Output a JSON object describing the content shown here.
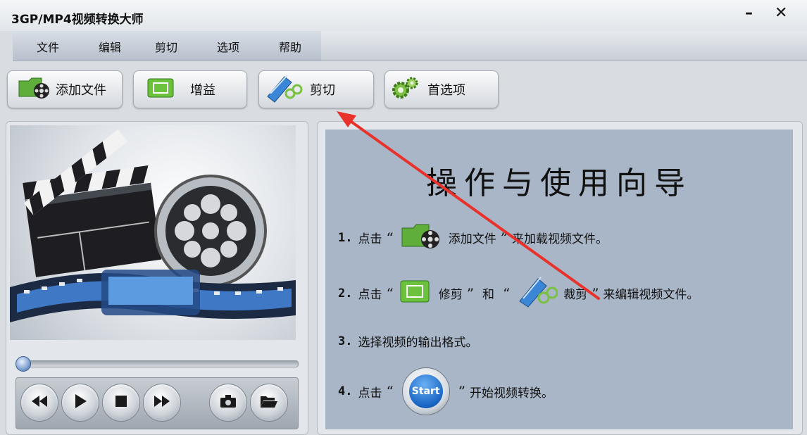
{
  "window": {
    "title": "3GP/MP4视频转换大师",
    "minimize_glyph": "–",
    "close_glyph": "✕"
  },
  "menu": {
    "items": [
      "文件",
      "编辑",
      "剪切",
      "选项",
      "帮助"
    ]
  },
  "toolbar": {
    "add_file": "添加文件",
    "gain": "增益",
    "cut": "剪切",
    "preferences": "首选项"
  },
  "player": {
    "seek_progress": 0,
    "controls": [
      "rewind-icon",
      "play-icon",
      "stop-icon",
      "fast-forward-icon",
      "snapshot-icon",
      "open-folder-icon"
    ]
  },
  "guide": {
    "title": "操作与使用向导",
    "step1": {
      "num": "1.",
      "prefix": "点击",
      "open_quote": "“",
      "label": "添加文件",
      "close_quote": "”",
      "suffix": "来加载视频文件。"
    },
    "step2": {
      "num": "2.",
      "prefix": "点击",
      "open_quote": "“",
      "label_a": "修剪",
      "close_quote": "”",
      "and": "和",
      "label_b": "裁剪",
      "suffix": "来编辑视频文件。"
    },
    "step3": {
      "num": "3.",
      "text": "选择视频的输出格式。"
    },
    "step4": {
      "num": "4.",
      "prefix": "点击",
      "open_quote": "“",
      "button": "Start",
      "close_quote": "”",
      "suffix": "开始视频转换。"
    }
  },
  "colors": {
    "annotation_arrow": "#e8322b",
    "guide_background": "#a9b6c7"
  }
}
